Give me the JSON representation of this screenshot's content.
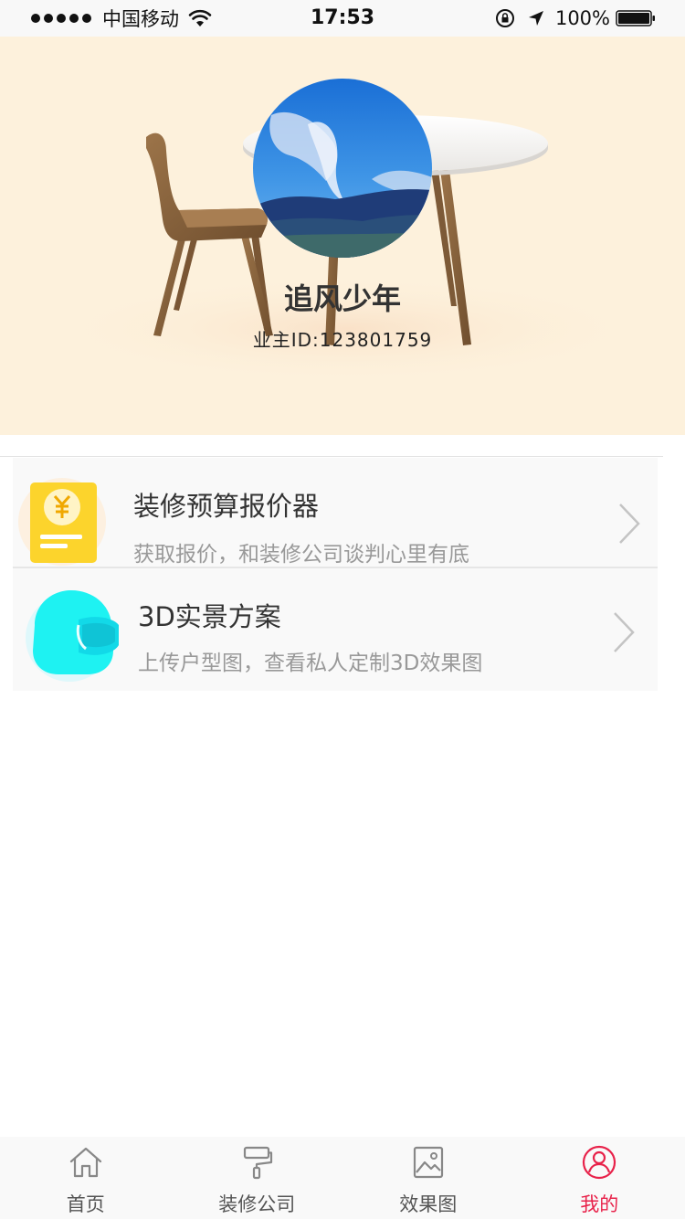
{
  "status_bar": {
    "carrier": "中国移动",
    "time": "17:53",
    "battery": "100%",
    "icons": [
      "signal-dots-icon",
      "wifi-icon",
      "rotation-lock-icon",
      "location-arrow-icon",
      "battery-icon"
    ]
  },
  "profile": {
    "name": "追风少年",
    "owner_id": "业主ID:123801759",
    "avatar_icon": "sky-landscape-avatar"
  },
  "services": [
    {
      "title": "装修预算报价器",
      "subtitle": "获取报价，和装修公司谈判心里有底",
      "icon": "budget-yen-icon",
      "icon_color": "#fcd42c"
    },
    {
      "title": "3D实景方案",
      "subtitle": "上传户型图，查看私人定制3D效果图",
      "icon": "vr-headset-icon",
      "icon_color": "#1ef2f2"
    }
  ],
  "tab_bar": {
    "active_color": "#e8224a",
    "tabs": [
      {
        "label": "首页",
        "icon": "home-icon",
        "active": false
      },
      {
        "label": "装修公司",
        "icon": "paint-roller-icon",
        "active": false
      },
      {
        "label": "效果图",
        "icon": "picture-icon",
        "active": false
      },
      {
        "label": "我的",
        "icon": "user-profile-icon",
        "active": true
      }
    ]
  }
}
